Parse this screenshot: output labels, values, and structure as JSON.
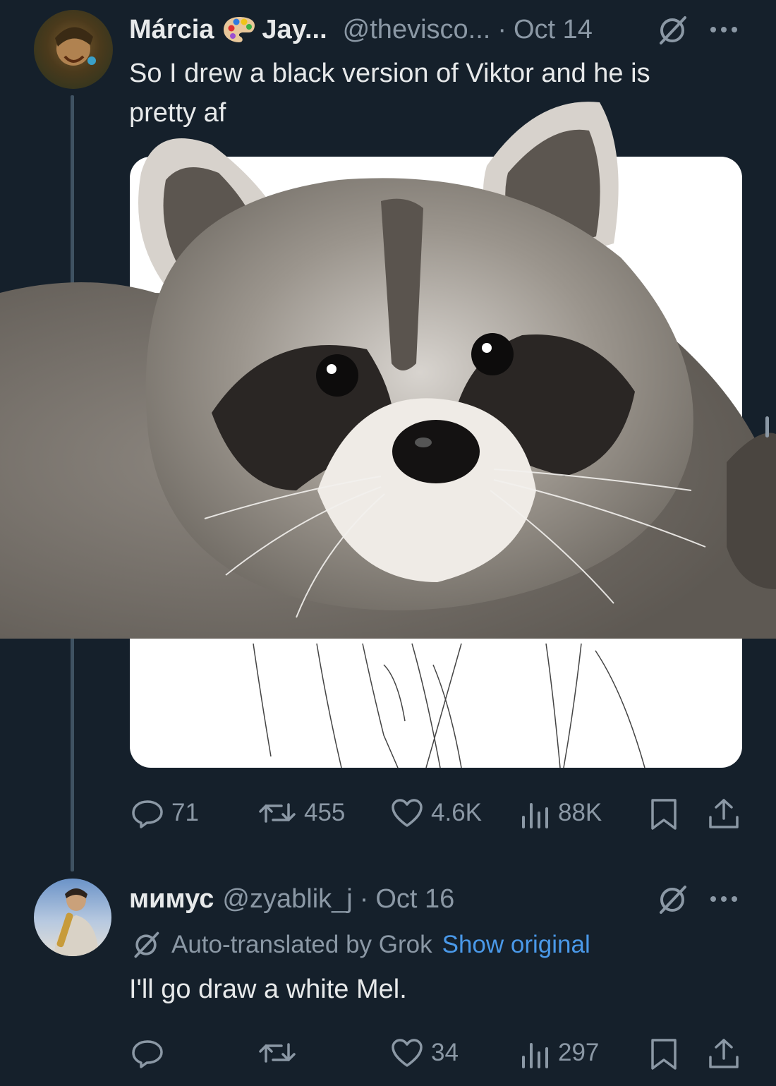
{
  "tweet1": {
    "display_name": "Márcia",
    "display_name_suffix": "Jay...",
    "handle": "@thevisco...",
    "separator": "·",
    "date": "Oct 14",
    "text_line1": "So I drew a black version of Viktor and he is",
    "text_line2": "pretty af",
    "stats": {
      "replies": "71",
      "reposts": "455",
      "likes": "4.6K",
      "views": "88K"
    },
    "emoji_icon": "artist-palette-icon"
  },
  "tweet2": {
    "display_name": "мимус",
    "handle": "@zyablik_j",
    "separator": "·",
    "date": "Oct 16",
    "translation_note": "Auto-translated by Grok",
    "show_original": "Show original",
    "text": "I'll go draw a white Mel.",
    "stats": {
      "replies": "",
      "reposts": "",
      "likes": "34",
      "views": "297"
    }
  },
  "colors": {
    "background": "#15202b",
    "text": "#e7e9ea",
    "muted": "#8b98a5",
    "link": "#4a99e9"
  }
}
